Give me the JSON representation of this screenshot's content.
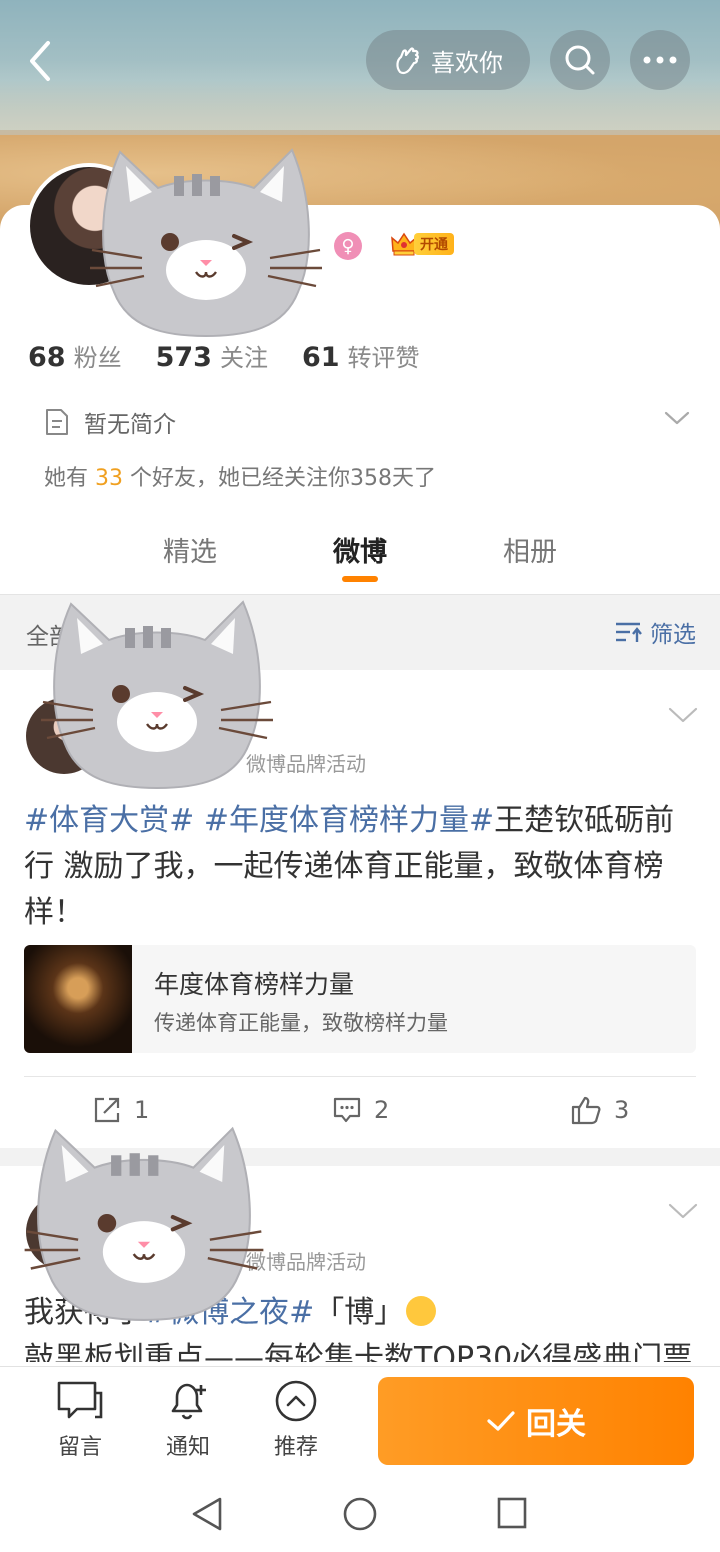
{
  "header": {
    "like_label": "喜欢你"
  },
  "profile": {
    "vip_label": "开通",
    "stats": [
      {
        "num": "68",
        "label": "粉丝"
      },
      {
        "num": "573",
        "label": "关注"
      },
      {
        "num": "61",
        "label": "转评赞"
      }
    ],
    "bio": "暂无简介",
    "friends": {
      "prefix": "她有",
      "count": "33",
      "suffix": "个好友，她已经关注你358天了"
    }
  },
  "tabs": [
    {
      "label": "精选"
    },
    {
      "label": "微博"
    },
    {
      "label": "相册"
    }
  ],
  "filter": {
    "all_label": "全部",
    "filter_label": "筛选"
  },
  "posts": [
    {
      "source": "微博品牌活动",
      "tag1": "#体育大赏#",
      "tag2": "#年度体育榜样力量#",
      "text": "王楚钦砥砺前行 激励了我，一起传递体育正能量，致敬体育榜样！",
      "link_title": "年度体育榜样力量",
      "link_sub": "传递体育正能量，致敬榜样力量",
      "reposts": "1",
      "comments": "2",
      "likes": "3"
    },
    {
      "source": "微博品牌活动",
      "text_prefix": "我获得了",
      "tag1": "#微博之夜#",
      "text_after": "「博」",
      "text_rest": "敲黑板划重点——每轮集卡数TOP30必得盛典门票"
    }
  ],
  "bottom": {
    "items": [
      {
        "label": "留言"
      },
      {
        "label": "通知"
      },
      {
        "label": "推荐"
      }
    ],
    "follow_label": "回关"
  },
  "icons": {
    "accent": "#ff8200",
    "link_blue": "#4a6fa5"
  }
}
